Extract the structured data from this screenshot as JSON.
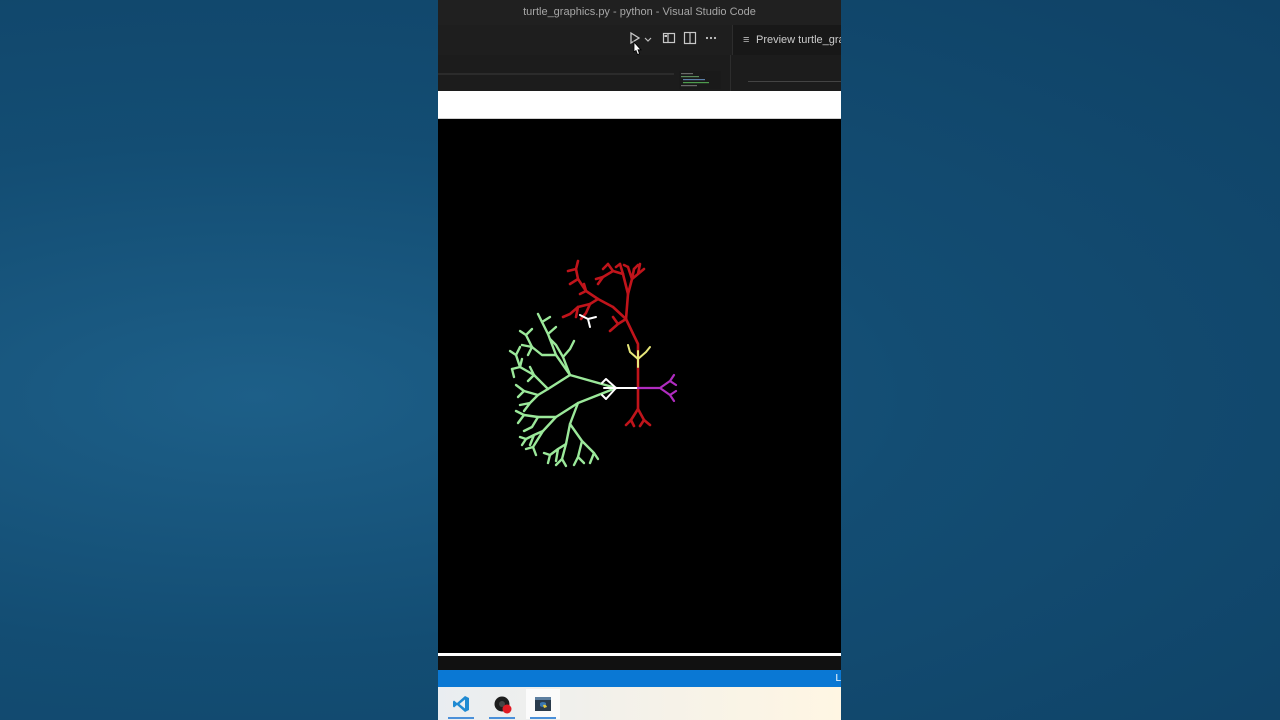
{
  "window": {
    "title": "turtle_graphics.py - python - Visual Studio Code"
  },
  "toolbar": {
    "run_icon": "play-icon",
    "run_dropdown_icon": "chevron-down-icon",
    "layout_icon": "open-preview-icon",
    "split_icon": "split-editor-icon",
    "more_icon": "ellipsis-icon"
  },
  "preview_tab": {
    "label": "Preview turtle_gra",
    "icon": "preview-lines-icon"
  },
  "statusbar": {
    "right_text": "L"
  },
  "taskbar": {
    "items": [
      {
        "icon": "vscode-icon"
      },
      {
        "icon": "recorder-icon"
      },
      {
        "icon": "python-turtle-icon"
      }
    ]
  },
  "colors": {
    "tree_red": "#c0141b",
    "tree_green": "#9be89a",
    "tree_yellow": "#e6e67a",
    "tree_purple": "#b02cc0",
    "tree_white": "#ffffff",
    "accent_blue": "#0a78d4"
  }
}
